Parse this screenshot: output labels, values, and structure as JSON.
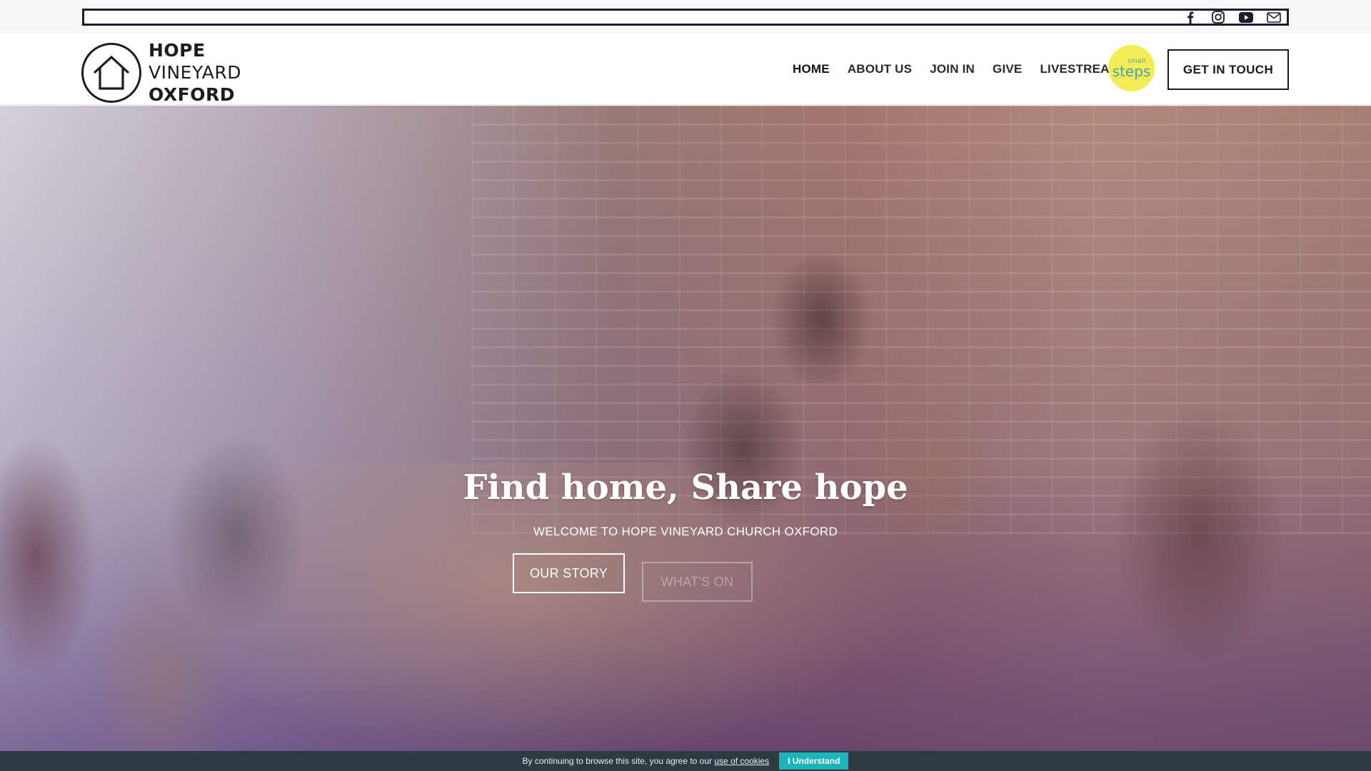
{
  "site": {
    "logo": {
      "line1": "HOPE",
      "line2": "VINEYARD",
      "line3": "OXFORD"
    }
  },
  "topbar": {
    "social": [
      "facebook-icon",
      "instagram-icon",
      "youtube-icon",
      "email-icon"
    ]
  },
  "nav": {
    "items": [
      {
        "label": "HOME",
        "active": true
      },
      {
        "label": "ABOUT US"
      },
      {
        "label": "JOIN IN"
      },
      {
        "label": "GIVE"
      },
      {
        "label": "LIVESTREAMS"
      }
    ],
    "small_steps": {
      "small": "small",
      "steps": "steps"
    },
    "cta_label": "GET IN TOUCH"
  },
  "hero": {
    "title": "Find home, Share hope",
    "subtitle": "WELCOME TO HOPE VINEYARD CHURCH OXFORD",
    "primary_button": "OUR STORY",
    "secondary_button": "WHAT'S ON"
  },
  "cookie": {
    "message": "By continuing to browse this site, you agree to our",
    "link": "use of cookies",
    "button": "I Understand"
  },
  "colors": {
    "dark": "#1c1c1c",
    "cookie_bg": "#2f3b43",
    "cookie_btn": "#1ab5b9",
    "small_steps_bg": "#f4ec54"
  }
}
